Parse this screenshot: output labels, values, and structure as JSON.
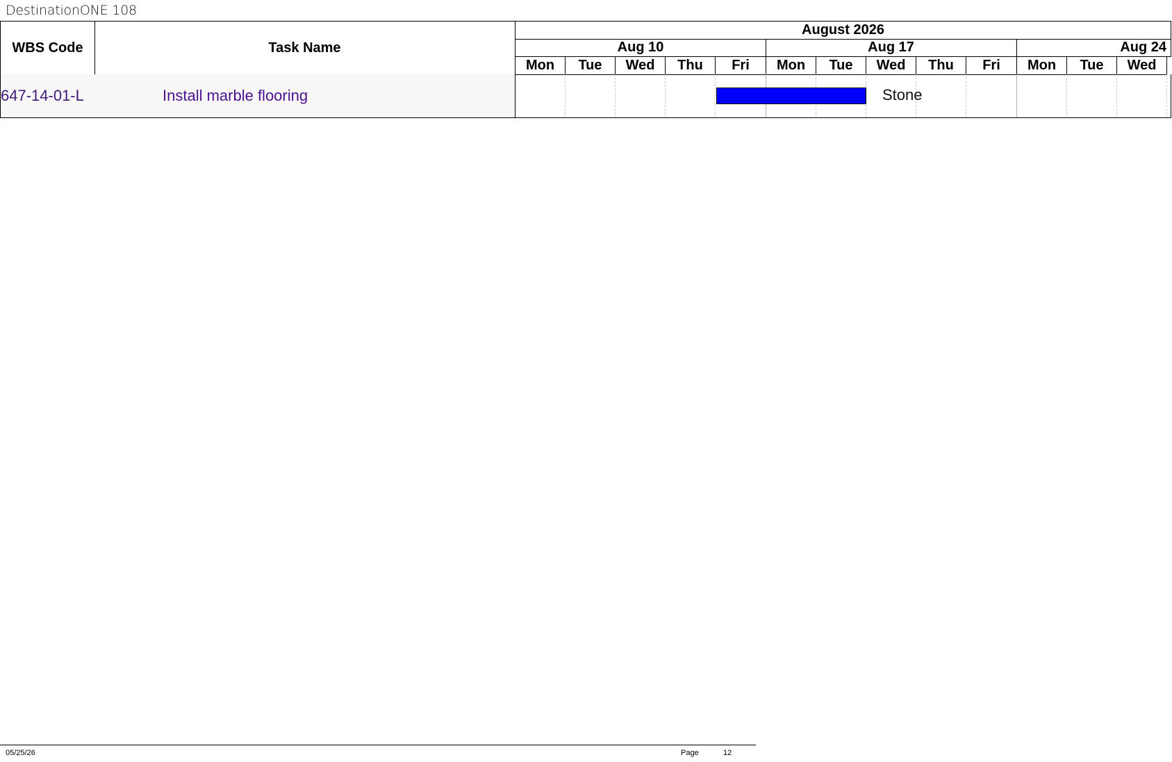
{
  "document": {
    "title": "DestinationONE 108"
  },
  "columns": {
    "wbs_header": "WBS Code",
    "task_header": "Task Name"
  },
  "timeline": {
    "month": "August 2026",
    "weeks": [
      "Aug 10",
      "Aug 17",
      "Aug 24"
    ],
    "days": [
      "Mon",
      "Tue",
      "Wed",
      "Thu",
      "Fri",
      "Mon",
      "Tue",
      "Wed",
      "Thu",
      "Fri",
      "Mon",
      "Tue",
      "Wed"
    ]
  },
  "tasks": [
    {
      "wbs": "647-14-01-L",
      "name": "Install marble flooring",
      "bar_start_day_index": 4,
      "bar_duration_days": 3,
      "resource": "Stone"
    }
  ],
  "colors": {
    "bar": "#0000ff",
    "task_text": "#4b0f8f"
  },
  "footer": {
    "date": "05/25/26",
    "page_label": "Page",
    "page_number": "12"
  }
}
